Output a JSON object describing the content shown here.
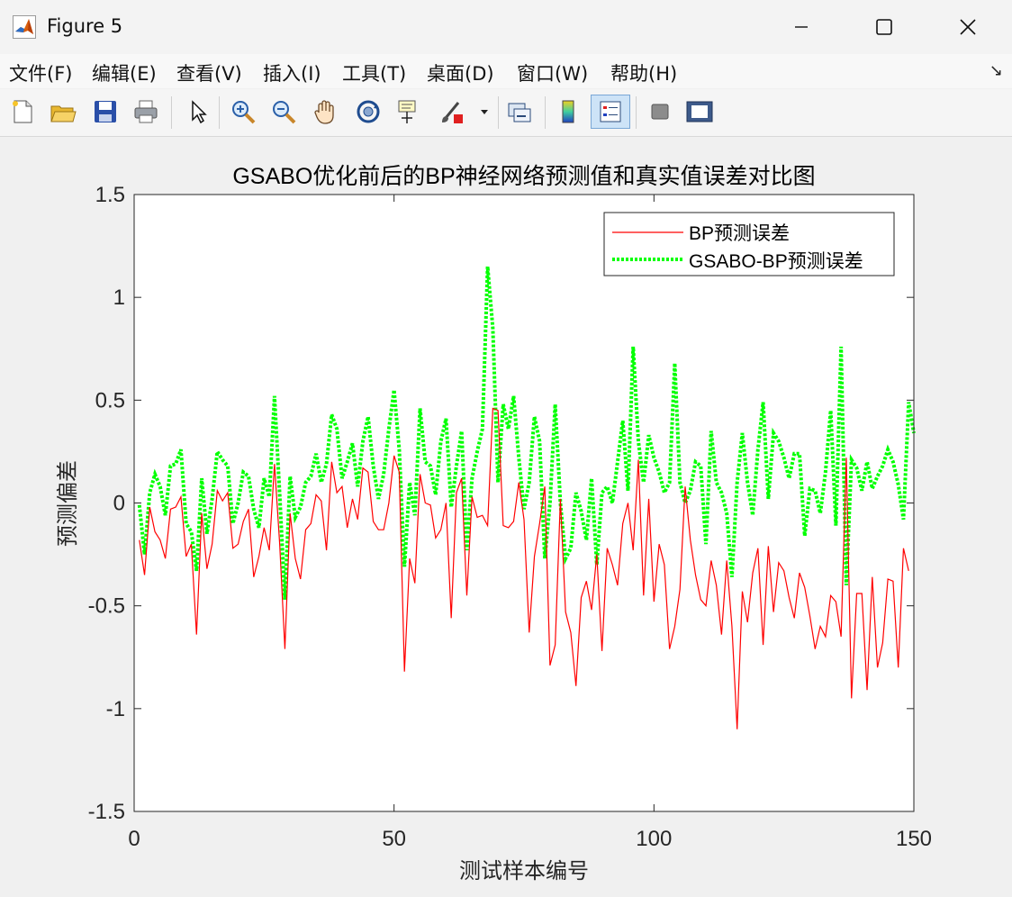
{
  "window": {
    "title": "Figure 5",
    "controls": {
      "minimize": "minimize",
      "maximize": "maximize",
      "close": "close"
    }
  },
  "menu": {
    "items": [
      "文件(F)",
      "编辑(E)",
      "查看(V)",
      "插入(I)",
      "工具(T)",
      "桌面(D)",
      "窗口(W)",
      "帮助(H)"
    ],
    "dock_arrow": "↘"
  },
  "toolbar": {
    "icons": [
      "new-figure-icon",
      "open-file-icon",
      "save-icon",
      "print-icon",
      "select-arrow-icon",
      "zoom-in-icon",
      "zoom-out-icon",
      "pan-hand-icon",
      "rotate-3d-icon",
      "data-cursor-icon",
      "brush-icon",
      "brush-dropdown-icon",
      "link-plot-icon",
      "colorbar-icon",
      "legend-icon",
      "hide-plot-tools-icon",
      "show-plot-tools-icon"
    ]
  },
  "colors": {
    "bp_series": "#ff0000",
    "gsabo_series": "#00ff00",
    "axes_background": "#ffffff",
    "figure_background": "#f0f0f0"
  },
  "chart_data": {
    "type": "line",
    "title": "GSABO优化前后的BP神经网络预测值和真实值误差对比图",
    "xlabel": "测试样本编号",
    "ylabel": "预测偏差",
    "xlim": [
      0,
      150
    ],
    "ylim": [
      -1.5,
      1.5
    ],
    "xticks": [
      0,
      50,
      100,
      150
    ],
    "xtick_labels": [
      "0",
      "50",
      "100",
      "150"
    ],
    "yticks": [
      -1.5,
      -1,
      -0.5,
      0,
      0.5,
      1,
      1.5
    ],
    "ytick_labels": [
      "-1.5",
      "-1",
      "-0.5",
      "0",
      "0.5",
      "1",
      "1.5"
    ],
    "legend_position": "top-right",
    "grid": false,
    "x": [
      1,
      2,
      3,
      4,
      5,
      6,
      7,
      8,
      9,
      10,
      11,
      12,
      13,
      14,
      15,
      16,
      17,
      18,
      19,
      20,
      21,
      22,
      23,
      24,
      25,
      26,
      27,
      28,
      29,
      30,
      31,
      32,
      33,
      34,
      35,
      36,
      37,
      38,
      39,
      40,
      41,
      42,
      43,
      44,
      45,
      46,
      47,
      48,
      49,
      50,
      51,
      52,
      53,
      54,
      55,
      56,
      57,
      58,
      59,
      60,
      61,
      62,
      63,
      64,
      65,
      66,
      67,
      68,
      69,
      70,
      71,
      72,
      73,
      74,
      75,
      76,
      77,
      78,
      79,
      80,
      81,
      82,
      83,
      84,
      85,
      86,
      87,
      88,
      89,
      90,
      91,
      92,
      93,
      94,
      95,
      96,
      97,
      98,
      99,
      100,
      101,
      102,
      103,
      104,
      105,
      106,
      107,
      108,
      109,
      110,
      111,
      112,
      113,
      114,
      115,
      116,
      117,
      118,
      119,
      120,
      121,
      122,
      123,
      124,
      125,
      126,
      127,
      128,
      129,
      130,
      131,
      132,
      133,
      134,
      135,
      136,
      137,
      138,
      139,
      140,
      141,
      142,
      143,
      144,
      145,
      146,
      147,
      148,
      149,
      150
    ],
    "series": [
      {
        "name": "BP预测误差",
        "style": "solid",
        "values": [
          -0.18,
          -0.35,
          -0.02,
          -0.14,
          -0.18,
          -0.27,
          -0.03,
          -0.02,
          0.03,
          -0.26,
          -0.2,
          -0.64,
          -0.05,
          -0.32,
          -0.2,
          0.06,
          0.01,
          0.05,
          -0.22,
          -0.2,
          -0.09,
          -0.03,
          -0.36,
          -0.26,
          -0.12,
          -0.23,
          0.19,
          -0.2,
          -0.71,
          -0.05,
          -0.27,
          -0.37,
          -0.13,
          -0.1,
          0.04,
          0.01,
          -0.23,
          0.2,
          0.05,
          0.08,
          -0.12,
          0.02,
          -0.08,
          0.17,
          0.15,
          -0.09,
          -0.13,
          -0.13,
          0.0,
          0.23,
          0.15,
          -0.82,
          -0.27,
          -0.39,
          0.14,
          0.0,
          -0.01,
          -0.17,
          -0.13,
          0.0,
          -0.56,
          0.05,
          0.12,
          -0.45,
          0.03,
          -0.07,
          -0.06,
          -0.11,
          0.46,
          0.45,
          -0.11,
          -0.12,
          -0.09,
          0.1,
          -0.08,
          -0.63,
          -0.26,
          -0.1,
          0.08,
          -0.79,
          -0.69,
          0.02,
          -0.53,
          -0.63,
          -0.89,
          -0.46,
          -0.38,
          -0.52,
          -0.25,
          -0.72,
          -0.22,
          -0.3,
          -0.4,
          -0.1,
          0.0,
          -0.23,
          0.21,
          -0.45,
          0.02,
          -0.48,
          -0.2,
          -0.3,
          -0.71,
          -0.6,
          -0.42,
          0.08,
          -0.18,
          -0.35,
          -0.47,
          -0.5,
          -0.28,
          -0.4,
          -0.64,
          -0.28,
          -0.6,
          -1.1,
          -0.43,
          -0.58,
          -0.34,
          -0.22,
          -0.69,
          -0.21,
          -0.53,
          -0.29,
          -0.33,
          -0.46,
          -0.56,
          -0.34,
          -0.41,
          -0.55,
          -0.71,
          -0.6,
          -0.65,
          -0.45,
          -0.48,
          -0.65,
          0.22,
          -0.95,
          -0.44,
          -0.44,
          -0.91,
          -0.36,
          -0.8,
          -0.68,
          -0.37,
          -0.38,
          -0.8,
          -0.22,
          -0.33
        ]
      },
      {
        "name": "GSABO-BP预测误差",
        "style": "dotted",
        "values": [
          -0.01,
          -0.25,
          0.05,
          0.14,
          0.08,
          -0.06,
          0.18,
          0.19,
          0.26,
          -0.1,
          -0.14,
          -0.33,
          0.12,
          -0.15,
          0.02,
          0.25,
          0.21,
          0.18,
          -0.1,
          0.0,
          0.15,
          0.13,
          -0.03,
          -0.12,
          0.12,
          0.03,
          0.52,
          0.04,
          -0.47,
          0.13,
          -0.07,
          -0.02,
          0.1,
          0.13,
          0.24,
          0.1,
          0.19,
          0.43,
          0.36,
          0.12,
          0.2,
          0.29,
          0.08,
          0.3,
          0.42,
          0.18,
          0.02,
          0.14,
          0.36,
          0.55,
          0.26,
          -0.31,
          0.1,
          -0.06,
          0.46,
          0.2,
          0.18,
          0.04,
          0.3,
          0.41,
          -0.02,
          0.18,
          0.35,
          -0.23,
          0.12,
          0.25,
          0.36,
          1.15,
          0.85,
          0.1,
          0.48,
          0.36,
          0.52,
          0.22,
          -0.03,
          0.1,
          0.42,
          0.3,
          -0.27,
          0.0,
          0.48,
          0.0,
          -0.27,
          -0.22,
          0.05,
          -0.04,
          -0.18,
          0.12,
          -0.3,
          0.05,
          0.08,
          0.0,
          0.2,
          0.4,
          0.06,
          0.76,
          0.3,
          0.1,
          0.33,
          0.22,
          0.15,
          0.05,
          0.1,
          0.68,
          0.1,
          0.0,
          0.06,
          0.2,
          0.18,
          -0.2,
          0.35,
          0.1,
          0.05,
          -0.05,
          -0.36,
          0.1,
          0.34,
          0.1,
          -0.06,
          0.26,
          0.49,
          0.02,
          0.34,
          0.3,
          0.22,
          0.12,
          0.24,
          0.24,
          -0.16,
          0.07,
          0.06,
          -0.05,
          0.15,
          0.45,
          -0.11,
          0.76,
          -0.4,
          0.21,
          0.17,
          0.06,
          0.2,
          0.07,
          0.13,
          0.18,
          0.26,
          0.2,
          0.09,
          -0.08,
          0.49,
          0.34
        ]
      }
    ]
  }
}
